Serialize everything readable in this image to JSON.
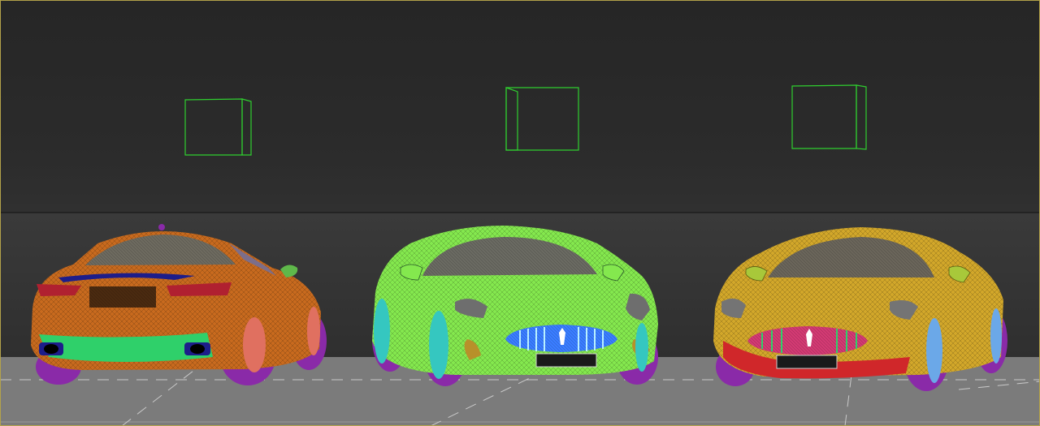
{
  "viewport": {
    "colors": {
      "background_top": "#262626",
      "background_bottom": "#3a3a3a",
      "horizon_line": "#111111",
      "ground": "#7b7b7b",
      "grid_line": "#d8d8d8",
      "frame": "#b3a24a",
      "light_helper": "#2fcf2f"
    }
  },
  "cars": [
    {
      "id": "car-left",
      "view": "rear",
      "colors": {
        "body": "#c86a1e",
        "lower": "#2fd06a",
        "wheel": "#8a2aa8",
        "rim": "#e07060",
        "light": "#b02030",
        "glass": "#6d6a5f"
      }
    },
    {
      "id": "car-middle",
      "view": "front",
      "colors": {
        "body": "#84e84e",
        "grille": "#3a7dff",
        "wheel": "#8a2aa8",
        "rim": "#35c7c0",
        "light": "#6e6e6e",
        "glass": "#6a6a62"
      }
    },
    {
      "id": "car-right",
      "view": "front",
      "colors": {
        "body": "#d2a72a",
        "grille": "#d23a73",
        "lower": "#d0272a",
        "wheel": "#8a2aa8",
        "rim": "#6ba8e8",
        "light": "#747474",
        "glass": "#6a655a"
      }
    }
  ],
  "plates": {
    "middle": "",
    "right": ""
  }
}
